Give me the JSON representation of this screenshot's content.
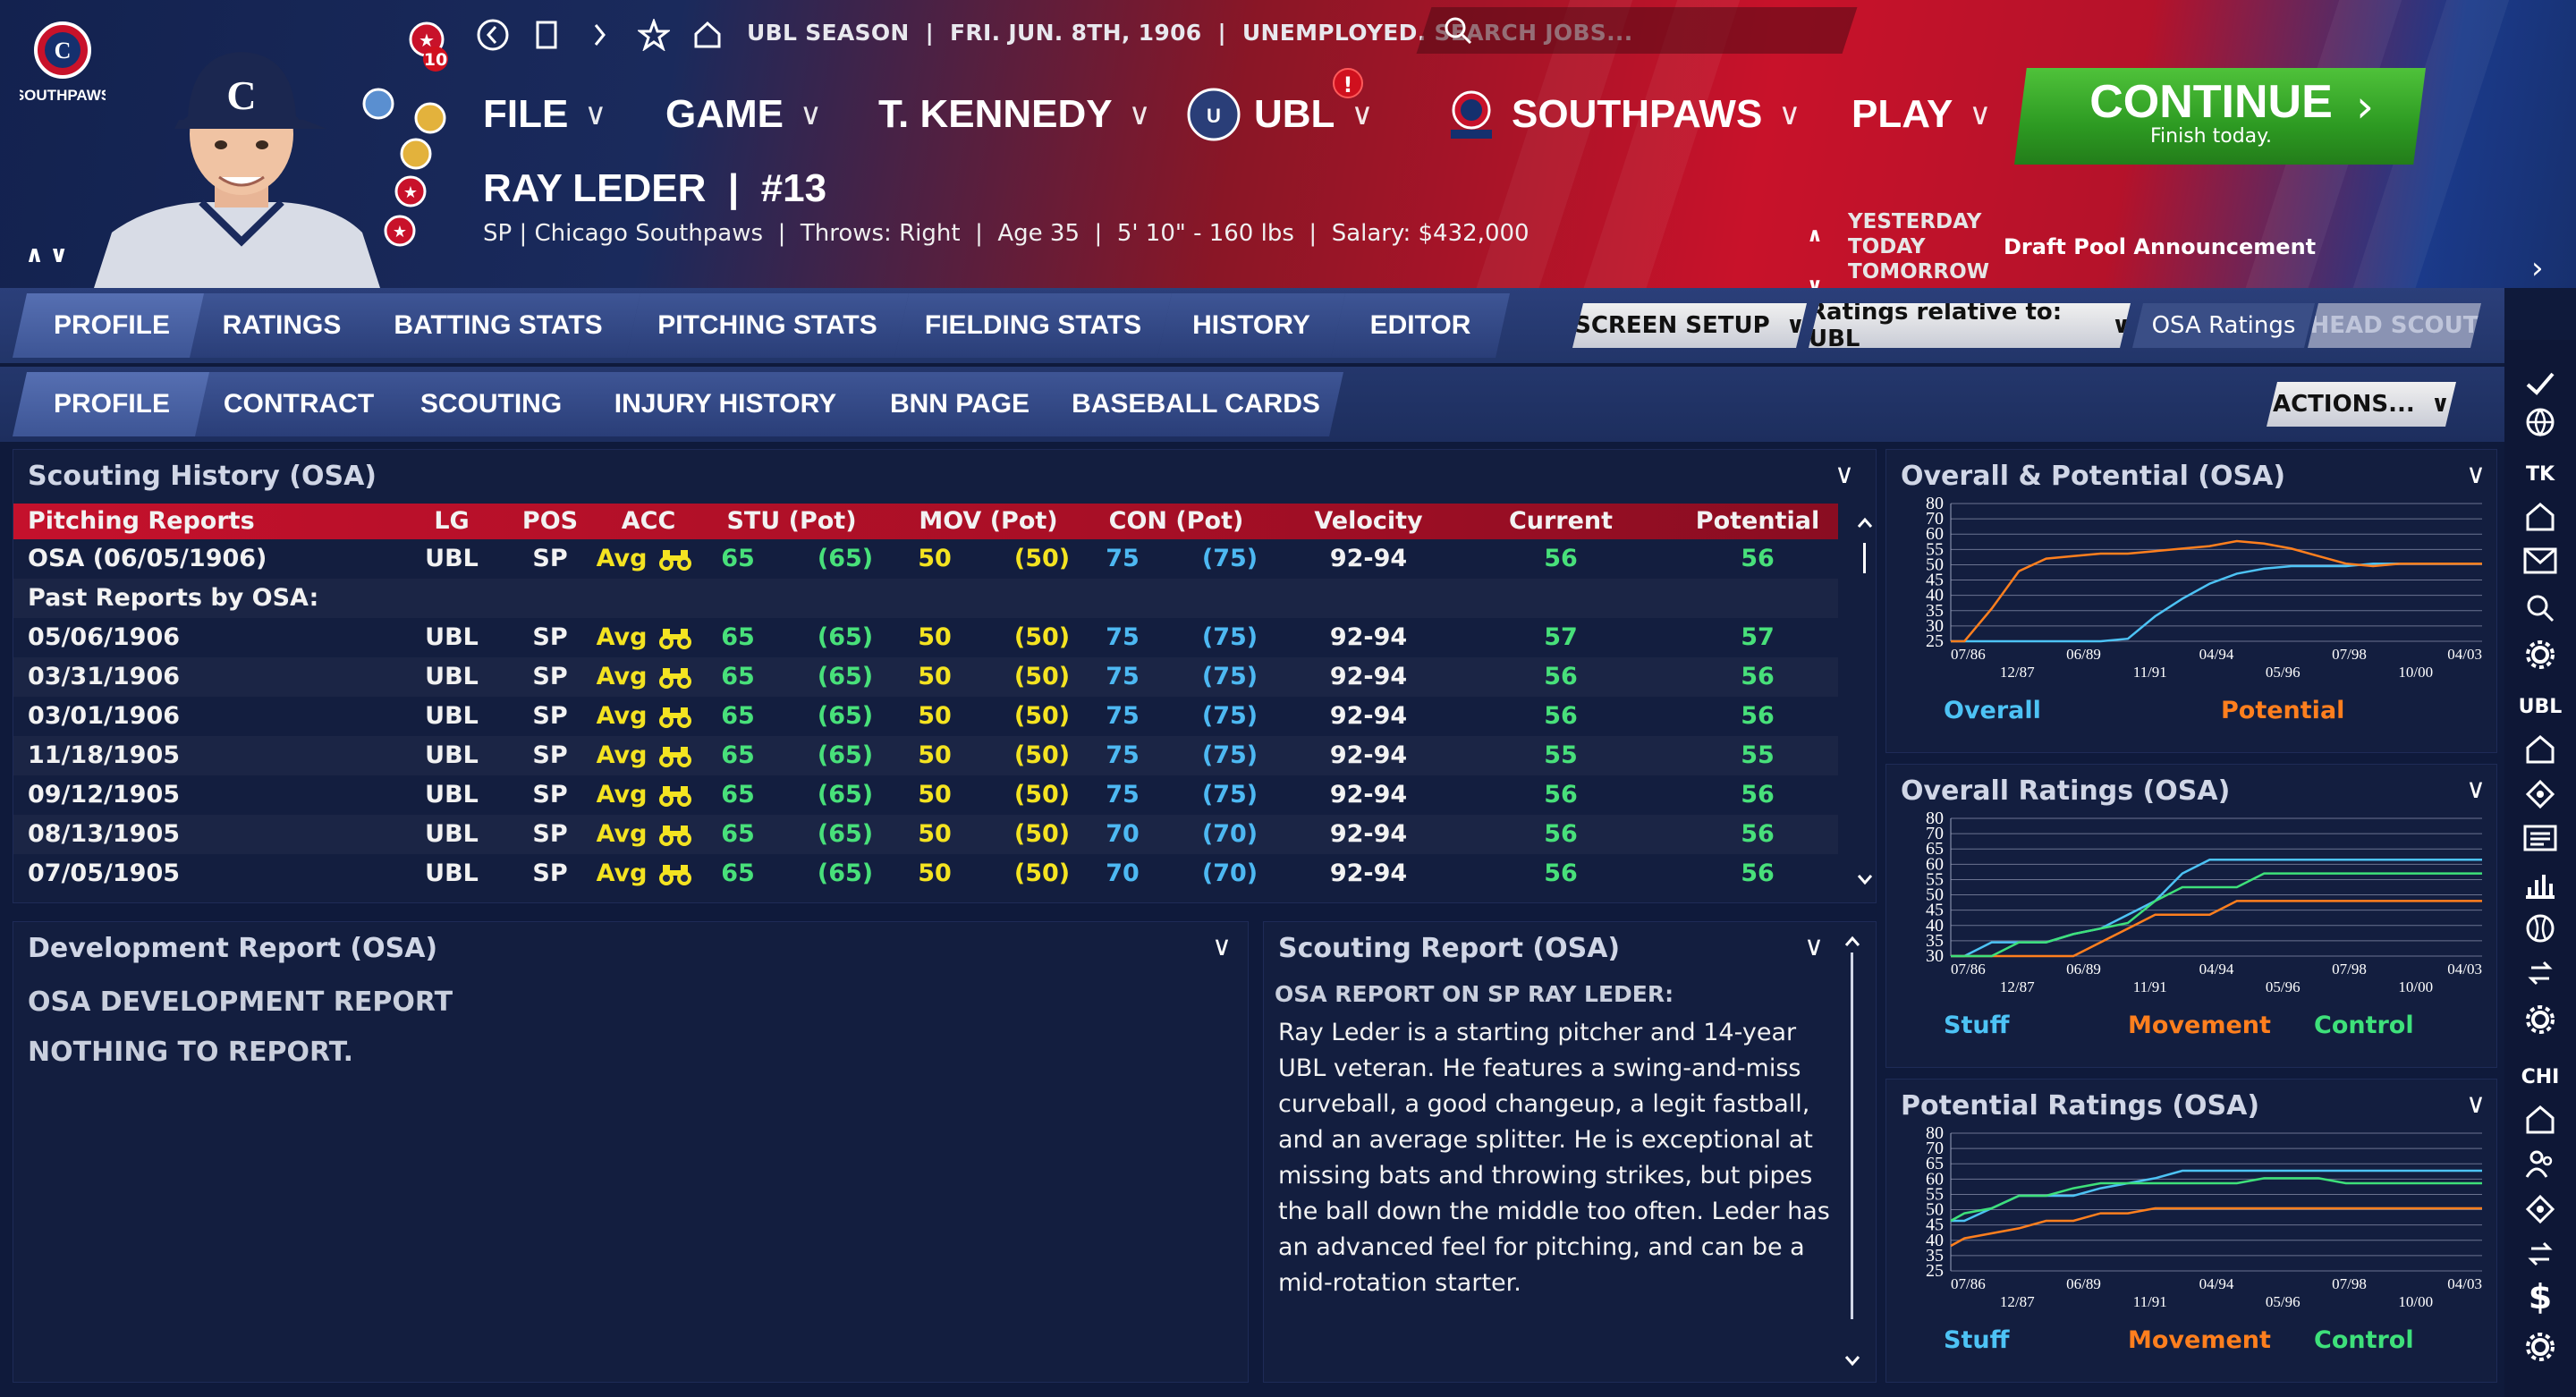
{
  "header": {
    "team_logo_text": "SOUTHPAWS",
    "nav_icons": [
      "back-arrow-icon",
      "bookmark-icon",
      "forward-arrow-icon",
      "star-icon",
      "home-icon"
    ],
    "status_text": "UBL SEASON  |  FRI. JUN. 8TH, 1906  |  UNEMPLOYED. SEARCH JOBS...",
    "badge_count": "10",
    "menu": {
      "file": "FILE",
      "game": "GAME",
      "manager": "T. KENNEDY",
      "league": "UBL",
      "league_alert": "!",
      "team": "SOUTHPAWS",
      "play": "PLAY"
    },
    "continue": {
      "label": "CONTINUE",
      "sub": "Finish today."
    },
    "player": {
      "name": "RAY LEDER  |  #13",
      "info": "SP | Chicago Southpaws  |  Throws: Right  |  Age 35  |  5' 10\" - 160 lbs  |  Salary: $432,000"
    },
    "day_nav": {
      "yesterday": "YESTERDAY",
      "today": "TODAY",
      "tomorrow": "TOMORROW",
      "event": "Draft Pool Announcement"
    }
  },
  "tabs_main": [
    "PROFILE",
    "RATINGS",
    "BATTING STATS",
    "PITCHING STATS",
    "FIELDING STATS",
    "HISTORY",
    "EDITOR"
  ],
  "tabs_main_controls": {
    "screen_setup": "SCREEN SETUP",
    "ratings_relative": "Ratings relative to: UBL",
    "osa": "OSA Ratings",
    "head_scout": "HEAD SCOUT"
  },
  "tabs_sub": [
    "PROFILE",
    "CONTRACT",
    "SCOUTING",
    "INJURY HISTORY",
    "BNN PAGE",
    "BASEBALL CARDS"
  ],
  "tabs_sub_actions": "ACTIONS...",
  "sidebar": {
    "tk": "TK",
    "ubl": "UBL",
    "chi": "CHI"
  },
  "scouting_history": {
    "title": "Scouting History (OSA)",
    "columns": [
      "Pitching Reports",
      "LG",
      "POS",
      "ACC",
      "STU (Pot)",
      "MOV (Pot)",
      "CON (Pot)",
      "Velocity",
      "Current",
      "Potential"
    ],
    "current": {
      "label": "OSA (06/05/1906)",
      "lg": "UBL",
      "pos": "SP",
      "acc": "Avg",
      "stu": "65",
      "stu_pot": "(65)",
      "mov": "50",
      "mov_pot": "(50)",
      "con": "75",
      "con_pot": "(75)",
      "vel": "92-94",
      "cur": "56",
      "pot": "56"
    },
    "past_label": "Past Reports by OSA:",
    "rows": [
      {
        "date": "05/06/1906",
        "lg": "UBL",
        "pos": "SP",
        "acc": "Avg",
        "stu": "65",
        "stu_pot": "(65)",
        "mov": "50",
        "mov_pot": "(50)",
        "con": "75",
        "con_pot": "(75)",
        "vel": "92-94",
        "cur": "57",
        "pot": "57"
      },
      {
        "date": "03/31/1906",
        "lg": "UBL",
        "pos": "SP",
        "acc": "Avg",
        "stu": "65",
        "stu_pot": "(65)",
        "mov": "50",
        "mov_pot": "(50)",
        "con": "75",
        "con_pot": "(75)",
        "vel": "92-94",
        "cur": "56",
        "pot": "56"
      },
      {
        "date": "03/01/1906",
        "lg": "UBL",
        "pos": "SP",
        "acc": "Avg",
        "stu": "65",
        "stu_pot": "(65)",
        "mov": "50",
        "mov_pot": "(50)",
        "con": "75",
        "con_pot": "(75)",
        "vel": "92-94",
        "cur": "56",
        "pot": "56"
      },
      {
        "date": "11/18/1905",
        "lg": "UBL",
        "pos": "SP",
        "acc": "Avg",
        "stu": "65",
        "stu_pot": "(65)",
        "mov": "50",
        "mov_pot": "(50)",
        "con": "75",
        "con_pot": "(75)",
        "vel": "92-94",
        "cur": "55",
        "pot": "55"
      },
      {
        "date": "09/12/1905",
        "lg": "UBL",
        "pos": "SP",
        "acc": "Avg",
        "stu": "65",
        "stu_pot": "(65)",
        "mov": "50",
        "mov_pot": "(50)",
        "con": "75",
        "con_pot": "(75)",
        "vel": "92-94",
        "cur": "56",
        "pot": "56"
      },
      {
        "date": "08/13/1905",
        "lg": "UBL",
        "pos": "SP",
        "acc": "Avg",
        "stu": "65",
        "stu_pot": "(65)",
        "mov": "50",
        "mov_pot": "(50)",
        "con": "70",
        "con_pot": "(70)",
        "vel": "92-94",
        "cur": "56",
        "pot": "56"
      },
      {
        "date": "07/05/1905",
        "lg": "UBL",
        "pos": "SP",
        "acc": "Avg",
        "stu": "65",
        "stu_pot": "(65)",
        "mov": "50",
        "mov_pot": "(50)",
        "con": "70",
        "con_pot": "(70)",
        "vel": "92-94",
        "cur": "56",
        "pot": "56"
      }
    ]
  },
  "development_report": {
    "title": "Development Report (OSA)",
    "heading": "OSA DEVELOPMENT REPORT",
    "body": "NOTHING TO REPORT."
  },
  "scouting_report": {
    "title": "Scouting Report (OSA)",
    "heading": "OSA REPORT ON SP RAY LEDER:",
    "body": "Ray Leder is a starting pitcher and 14-year UBL veteran. He features a swing-and-miss curveball, a good changeup, a legit fastball, and an average splitter. He is exceptional at missing bats and throwing strikes, but pipes the ball down the middle too often. Leder has an advanced feel for pitching, and can be a mid-rotation starter."
  },
  "colors": {
    "stuff": "#4dc3f5",
    "movement": "#ff7f1e",
    "control": "#3ee07a",
    "overall": "#4dc3f5",
    "potential": "#ff7f1e"
  },
  "chart_data": [
    {
      "type": "line",
      "title": "Overall & Potential (OSA)",
      "yticks": [
        "80",
        "70",
        "60",
        "55",
        "50",
        "45",
        "40",
        "35",
        "30",
        "25"
      ],
      "xticks_top": [
        "07/86",
        "06/89",
        "04/94",
        "07/98",
        "04/03"
      ],
      "xticks_bottom": [
        "12/87",
        "11/91",
        "05/96",
        "10/00"
      ],
      "ylim": [
        25,
        80
      ],
      "x": [
        1886.5,
        1887,
        1888,
        1889,
        1890,
        1891,
        1892,
        1893,
        1894,
        1895,
        1896,
        1897,
        1898,
        1899,
        1900,
        1901,
        1902,
        1903,
        1904,
        1905,
        1906
      ],
      "series": [
        {
          "name": "Overall",
          "values": [
            25,
            25,
            25,
            25,
            25,
            25,
            25,
            26,
            35,
            42,
            48,
            52,
            54,
            55,
            55,
            55,
            56,
            56,
            56,
            56,
            56
          ]
        },
        {
          "name": "Potential",
          "values": [
            25,
            25,
            38,
            53,
            58,
            59,
            60,
            60,
            61,
            62,
            63,
            65,
            64,
            62,
            59,
            56,
            55,
            56,
            56,
            56,
            56
          ]
        }
      ]
    },
    {
      "type": "line",
      "title": "Overall Ratings (OSA)",
      "yticks": [
        "80",
        "70",
        "65",
        "60",
        "55",
        "50",
        "45",
        "40",
        "35",
        "30"
      ],
      "xticks_top": [
        "07/86",
        "06/89",
        "04/94",
        "07/98",
        "04/03"
      ],
      "xticks_bottom": [
        "12/87",
        "11/91",
        "05/96",
        "10/00"
      ],
      "ylim": [
        30,
        80
      ],
      "x": [
        1886.5,
        1887,
        1888,
        1889,
        1890,
        1891,
        1892,
        1893,
        1894,
        1895,
        1896,
        1897,
        1898,
        1899,
        1900,
        1901,
        1902,
        1903,
        1904,
        1905,
        1906
      ],
      "series": [
        {
          "name": "Stuff",
          "values": [
            30,
            30,
            35,
            35,
            35,
            38,
            40,
            45,
            50,
            60,
            65,
            65,
            65,
            65,
            65,
            65,
            65,
            65,
            65,
            65,
            65
          ]
        },
        {
          "name": "Movement",
          "values": [
            30,
            30,
            30,
            30,
            30,
            30,
            35,
            40,
            45,
            45,
            45,
            50,
            50,
            50,
            50,
            50,
            50,
            50,
            50,
            50,
            50
          ]
        },
        {
          "name": "Control",
          "values": [
            30,
            30,
            30,
            35,
            35,
            38,
            40,
            42,
            50,
            55,
            55,
            55,
            60,
            60,
            60,
            60,
            60,
            60,
            60,
            60,
            60
          ]
        }
      ]
    },
    {
      "type": "line",
      "title": "Potential Ratings (OSA)",
      "yticks": [
        "80",
        "70",
        "65",
        "60",
        "55",
        "50",
        "45",
        "40",
        "35",
        "25"
      ],
      "xticks_top": [
        "07/86",
        "06/89",
        "04/94",
        "07/98",
        "04/03"
      ],
      "xticks_bottom": [
        "12/87",
        "11/91",
        "05/96",
        "10/00"
      ],
      "ylim": [
        25,
        80
      ],
      "x": [
        1886.5,
        1887,
        1888,
        1889,
        1890,
        1891,
        1892,
        1893,
        1894,
        1895,
        1896,
        1897,
        1898,
        1899,
        1900,
        1901,
        1902,
        1903,
        1904,
        1905,
        1906
      ],
      "series": [
        {
          "name": "Stuff",
          "values": [
            45,
            45,
            50,
            55,
            55,
            55,
            58,
            60,
            62,
            65,
            65,
            65,
            65,
            65,
            65,
            65,
            65,
            65,
            65,
            65,
            65
          ]
        },
        {
          "name": "Movement",
          "values": [
            35,
            38,
            40,
            42,
            45,
            45,
            48,
            48,
            50,
            50,
            50,
            50,
            50,
            50,
            50,
            50,
            50,
            50,
            50,
            50,
            50
          ]
        },
        {
          "name": "Control",
          "values": [
            45,
            48,
            50,
            55,
            55,
            58,
            60,
            60,
            60,
            60,
            60,
            60,
            62,
            62,
            62,
            60,
            60,
            60,
            60,
            60,
            60
          ]
        }
      ]
    }
  ]
}
